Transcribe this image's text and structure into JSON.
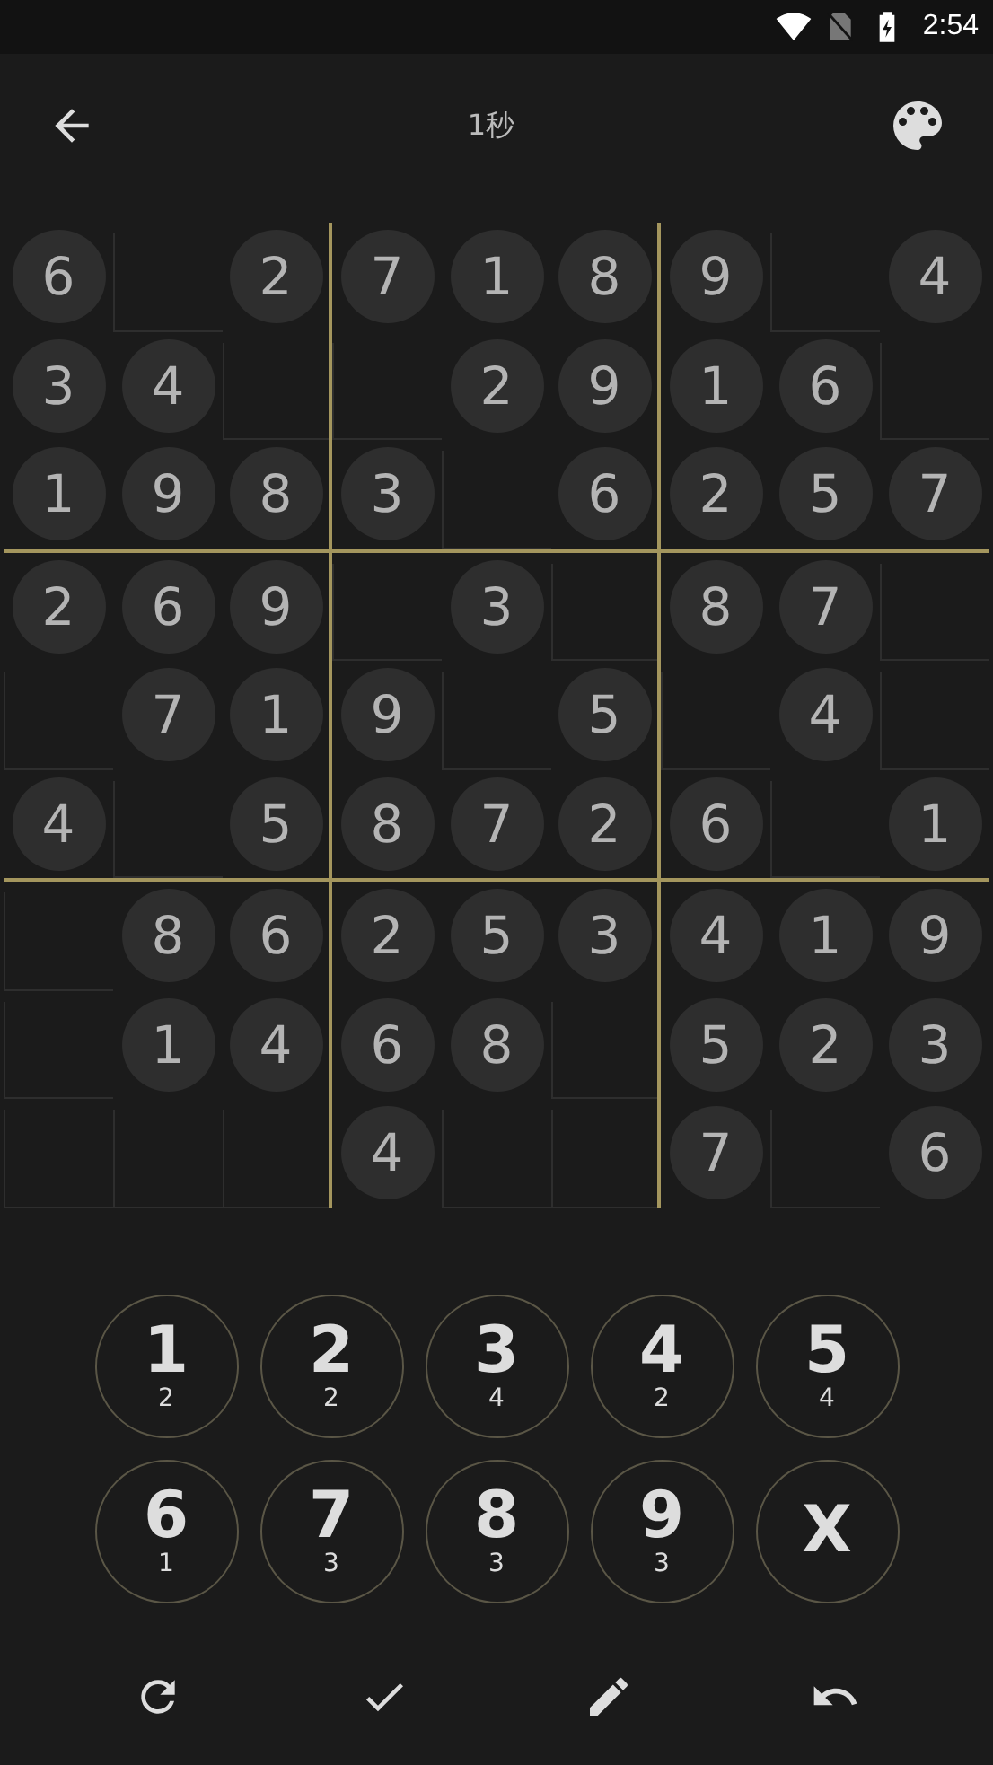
{
  "status_bar": {
    "time": "2:54"
  },
  "app_bar": {
    "title": "1秒"
  },
  "board": {
    "rows": [
      [
        "6",
        null,
        "2",
        "7",
        "1",
        "8",
        "9",
        null,
        "4"
      ],
      [
        "3",
        "4",
        null,
        null,
        "2",
        "9",
        "1",
        "6",
        null
      ],
      [
        "1",
        "9",
        "8",
        "3",
        null,
        "6",
        "2",
        "5",
        "7"
      ],
      [
        "2",
        "6",
        "9",
        null,
        "3",
        null,
        "8",
        "7",
        null
      ],
      [
        null,
        "7",
        "1",
        "9",
        null,
        "5",
        null,
        "4",
        null
      ],
      [
        "4",
        null,
        "5",
        "8",
        "7",
        "2",
        "6",
        null,
        "1"
      ],
      [
        null,
        "8",
        "6",
        "2",
        "5",
        "3",
        "4",
        "1",
        "9"
      ],
      [
        null,
        "1",
        "4",
        "6",
        "8",
        null,
        "5",
        "2",
        "3"
      ],
      [
        null,
        null,
        null,
        "4",
        null,
        null,
        "7",
        null,
        "6"
      ]
    ]
  },
  "keypad": [
    {
      "label": "1",
      "count": "2"
    },
    {
      "label": "2",
      "count": "2"
    },
    {
      "label": "3",
      "count": "4"
    },
    {
      "label": "4",
      "count": "2"
    },
    {
      "label": "5",
      "count": "4"
    },
    {
      "label": "6",
      "count": "1"
    },
    {
      "label": "7",
      "count": "3"
    },
    {
      "label": "8",
      "count": "3"
    },
    {
      "label": "9",
      "count": "3"
    },
    {
      "label": "X"
    }
  ],
  "toolbar": [
    {
      "kind": "restart"
    },
    {
      "kind": "check"
    },
    {
      "kind": "pencil"
    },
    {
      "kind": "undo"
    }
  ]
}
